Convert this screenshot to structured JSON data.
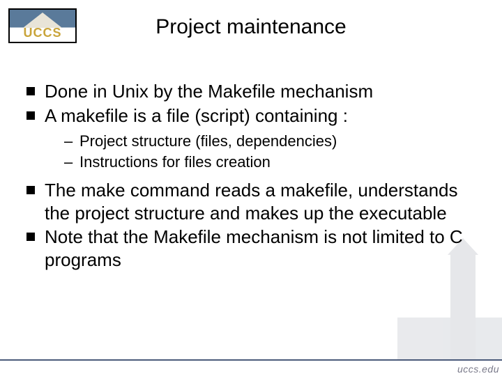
{
  "logo": {
    "text": "UCCS"
  },
  "title": "Project maintenance",
  "bullets": [
    {
      "text": "Done in Unix by the Makefile mechanism"
    },
    {
      "text": "A makefile is a file (script) containing :",
      "sub": [
        "Project structure (files, dependencies)",
        "Instructions for files creation"
      ]
    },
    {
      "text": "The make command reads a makefile, understands the project structure and makes up the executable"
    },
    {
      "text": "Note that the Makefile mechanism is not limited to C programs"
    }
  ],
  "footer": {
    "url": "uccs.edu"
  }
}
